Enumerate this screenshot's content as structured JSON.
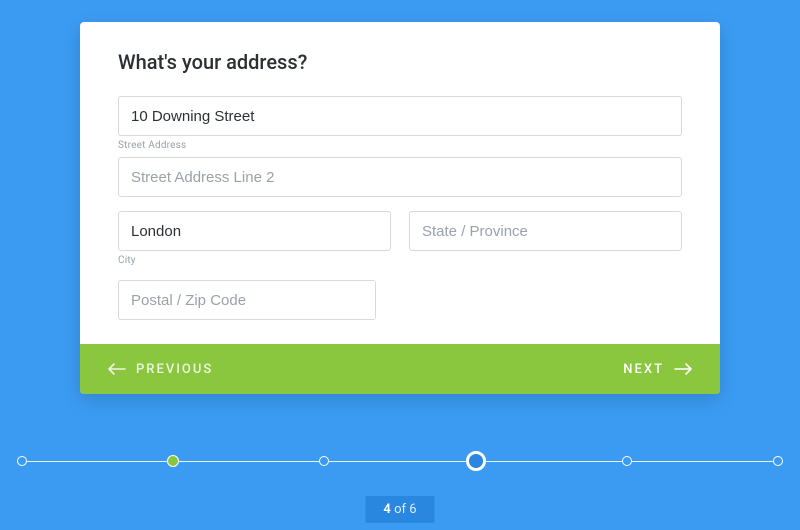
{
  "form": {
    "title": "What's your address?",
    "street": {
      "value": "10 Downing Street",
      "placeholder": "",
      "label": "Street Address"
    },
    "street2": {
      "value": "",
      "placeholder": "Street Address Line 2"
    },
    "city": {
      "value": "London",
      "placeholder": "",
      "label": "City"
    },
    "state": {
      "value": "",
      "placeholder": "State / Province"
    },
    "postal": {
      "value": "",
      "placeholder": "Postal / Zip Code"
    }
  },
  "nav": {
    "previous": "PREVIOUS",
    "next": "NEXT"
  },
  "progress": {
    "current": 4,
    "total": 6,
    "pill_current": "4",
    "pill_of": " of ",
    "pill_total": "6"
  }
}
